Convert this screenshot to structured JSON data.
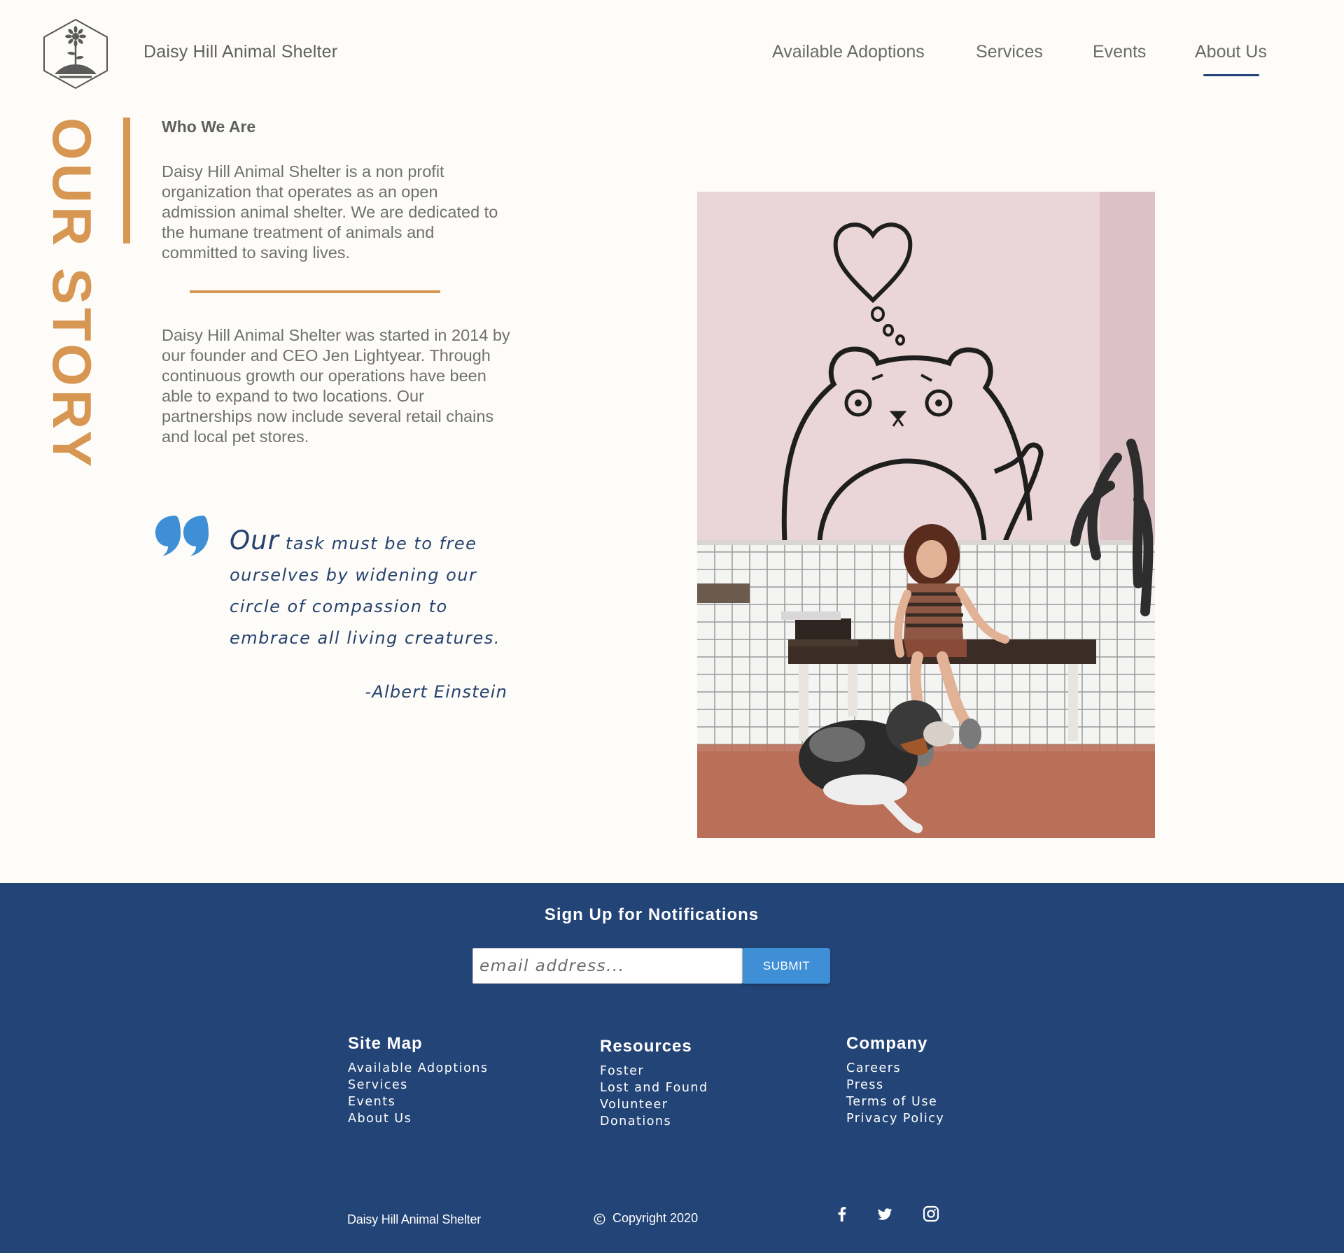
{
  "header": {
    "brand_name": "Daisy Hill Animal Shelter",
    "nav": [
      {
        "label": "Available Adoptions"
      },
      {
        "label": "Services"
      },
      {
        "label": "Events"
      },
      {
        "label": "About Us",
        "active": true
      }
    ]
  },
  "story": {
    "side_heading": "OUR STORY",
    "section_title": "Who We Are",
    "paragraph_1": "Daisy Hill Animal Shelter is a non profit organization that operates as an open admission animal shelter. We are dedicated to the humane treatment of animals and committed to saving lives.",
    "paragraph_2": "Daisy Hill Animal Shelter was started in 2014 by our founder and CEO Jen Lightyear. Through continuous growth our operations have been able to expand to two locations. Our partnerships now include several retail chains and local pet stores.",
    "quote_first_word": "Our",
    "quote_rest": " task must be to free ourselves by widening our circle of compassion to embrace all living creatures.",
    "quote_author": "-Albert Einstein"
  },
  "footer": {
    "signup_title": "Sign Up for Notifications",
    "email_placeholder": "email address...",
    "submit_label": "SUBMIT",
    "columns": [
      {
        "title": "Site Map",
        "links": [
          "Available Adoptions",
          "Services",
          "Events",
          "About Us"
        ]
      },
      {
        "title": "Resources",
        "links": [
          "Foster",
          "Lost and Found",
          "Volunteer",
          "Donations"
        ]
      },
      {
        "title": "Company",
        "links": [
          "Careers",
          "Press",
          "Terms of Use",
          "Privacy Policy"
        ]
      }
    ],
    "brand_name": "Daisy Hill Animal Shelter",
    "copyright": "Copyright 2020",
    "social_icons": [
      "facebook-icon",
      "twitter-icon",
      "instagram-icon"
    ]
  },
  "colors": {
    "page_background": "#fdfcf8",
    "accent_orange": "#d79652",
    "navy": "#234476",
    "quote_blue": "#3f8fd6",
    "text_gray": "#707070"
  }
}
